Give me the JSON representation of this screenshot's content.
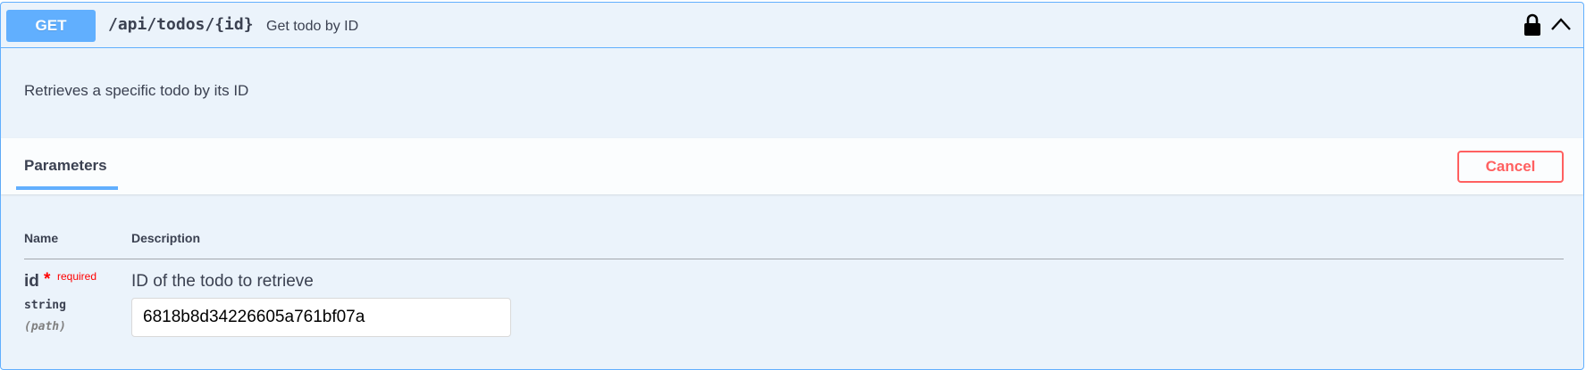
{
  "operation": {
    "method": "GET",
    "path": "/api/todos/{id}",
    "summary": "Get todo by ID",
    "description": "Retrieves a specific todo by its ID"
  },
  "parameters_section": {
    "tab_label": "Parameters",
    "cancel_label": "Cancel",
    "columns": {
      "name": "Name",
      "description": "Description"
    },
    "params": [
      {
        "name": "id",
        "required_mark": "*",
        "required_label": "required",
        "type": "string",
        "in": "(path)",
        "description": "ID of the todo to retrieve",
        "value": "6818b8d34226605a761bf07a"
      }
    ]
  },
  "colors": {
    "get_accent": "#61affe",
    "cancel_red": "#ff6060",
    "required_red": "#ff0000",
    "block_bg": "#ebf3fb"
  },
  "icons": {
    "lock": "lock-icon",
    "collapse": "chevron-up-icon"
  }
}
